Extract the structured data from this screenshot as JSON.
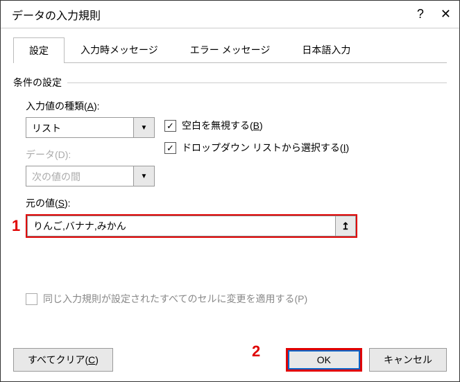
{
  "titlebar": {
    "title": "データの入力規則"
  },
  "tabs": {
    "settings": "設定",
    "input_msg": "入力時メッセージ",
    "error_msg": "エラー メッセージ",
    "ime": "日本語入力"
  },
  "fieldset": {
    "legend": "条件の設定"
  },
  "allow": {
    "label_pre": "入力値の種類(",
    "label_key": "A",
    "label_post": "):",
    "value": "リスト"
  },
  "data_field": {
    "label": "データ(D):",
    "value": "次の値の間"
  },
  "checks": {
    "ignore_blank_pre": "空白を無視する(",
    "ignore_blank_key": "B",
    "ignore_blank_post": ")",
    "dropdown_pre": "ドロップダウン リストから選択する(",
    "dropdown_key": "I",
    "dropdown_post": ")"
  },
  "source": {
    "label_pre": "元の値(",
    "label_key": "S",
    "label_post": "):",
    "value": "りんご,バナナ,みかん"
  },
  "apply": {
    "label": "同じ入力規則が設定されたすべてのセルに変更を適用する(P)"
  },
  "footer": {
    "clear_pre": "すべてクリア(",
    "clear_key": "C",
    "clear_post": ")",
    "ok": "OK",
    "cancel": "キャンセル"
  },
  "annotations": {
    "one": "1",
    "two": "2"
  }
}
